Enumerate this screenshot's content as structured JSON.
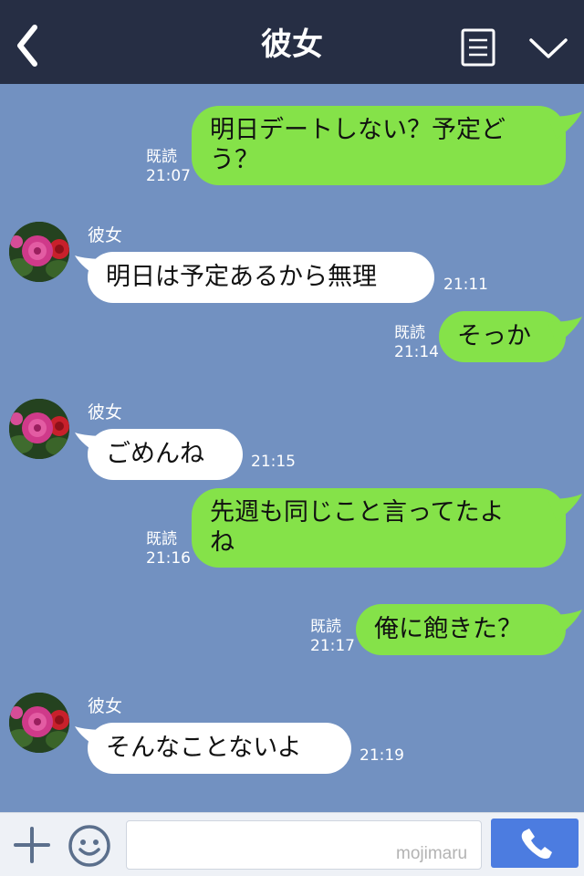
{
  "header": {
    "title": "彼女",
    "back_icon": "chevron-left-icon",
    "menu_icon": "menu-icon",
    "collapse_icon": "chevron-down-icon",
    "bg_color": "#262e44"
  },
  "chat": {
    "bg_color": "#7291c1",
    "outgoing_bubble_color": "#85e249",
    "incoming_bubble_color": "#ffffff",
    "messages": [
      {
        "direction": "out",
        "lines": [
          "明日デートしない？予定ど",
          "う？"
        ],
        "read": "既読",
        "time": "21:07"
      },
      {
        "direction": "in",
        "sender": "彼女",
        "text": "明日は予定あるから無理",
        "time": "21:11"
      },
      {
        "direction": "out",
        "text": "そっか",
        "read": "既読",
        "time": "21:14"
      },
      {
        "direction": "in",
        "sender": "彼女",
        "text": "ごめんね",
        "time": "21:15"
      },
      {
        "direction": "out",
        "lines": [
          "先週も同じこと言ってたよ",
          "ね"
        ],
        "read": "既読",
        "time": "21:16"
      },
      {
        "direction": "out",
        "text": "俺に飽きた？",
        "read": "既読",
        "time": "21:17"
      },
      {
        "direction": "in",
        "sender": "彼女",
        "text": "そんなことないよ",
        "time": "21:19"
      }
    ]
  },
  "input_bar": {
    "value": "",
    "watermark": "mojimaru",
    "plus_icon": "plus-icon",
    "emoji_icon": "smiley-icon",
    "call_icon": "phone-icon",
    "call_button_color": "#4c7ce0"
  }
}
